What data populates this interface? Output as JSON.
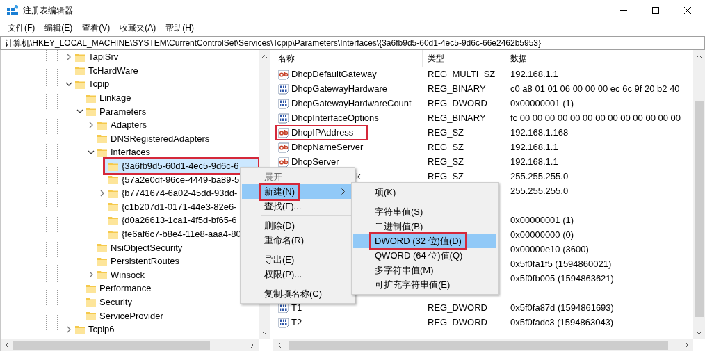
{
  "window": {
    "title": "注册表编辑器"
  },
  "menu_bar": [
    "文件(F)",
    "编辑(E)",
    "查看(V)",
    "收藏夹(A)",
    "帮助(H)"
  ],
  "address_bar": {
    "value": "计算机\\HKEY_LOCAL_MACHINE\\SYSTEM\\CurrentControlSet\\Services\\Tcpip\\Parameters\\Interfaces\\{3a6fb9d5-60d1-4ec5-9d6c-66e2462b5953}"
  },
  "tree": [
    {
      "label": "TapiSrv",
      "kind": "branch",
      "expanded": false,
      "selected": false
    },
    {
      "label": "TcHardWare",
      "kind": "leaf",
      "selected": false
    },
    {
      "label": "Tcpip",
      "kind": "branch",
      "expanded": true,
      "selected": false,
      "children": [
        {
          "label": "Linkage",
          "kind": "leaf",
          "selected": false
        },
        {
          "label": "Parameters",
          "kind": "branch",
          "expanded": true,
          "selected": false,
          "children": [
            {
              "label": "Adapters",
              "kind": "branch",
              "expanded": false,
              "selected": false
            },
            {
              "label": "DNSRegisteredAdapters",
              "kind": "leaf",
              "selected": false
            },
            {
              "label": "Interfaces",
              "kind": "branch",
              "expanded": true,
              "selected": false,
              "children": [
                {
                  "label": "{3a6fb9d5-60d1-4ec5-9d6c-6",
                  "kind": "leaf",
                  "selected": true,
                  "annotated": true
                },
                {
                  "label": "{57a2e0df-96ce-4449-ba89-5",
                  "kind": "leaf",
                  "selected": false
                },
                {
                  "label": "{b7741674-6a02-45dd-93dd-",
                  "kind": "branch",
                  "expanded": false,
                  "selected": false
                },
                {
                  "label": "{c1b207d1-0171-44e3-82e6-",
                  "kind": "leaf",
                  "selected": false
                },
                {
                  "label": "{d0a26613-1ca1-4f5d-bf65-6",
                  "kind": "leaf",
                  "selected": false
                },
                {
                  "label": "{fe6af6c7-b8e4-11e8-aaa4-80",
                  "kind": "leaf",
                  "selected": false
                }
              ]
            },
            {
              "label": "NsiObjectSecurity",
              "kind": "leaf",
              "selected": false
            },
            {
              "label": "PersistentRoutes",
              "kind": "leaf",
              "selected": false
            },
            {
              "label": "Winsock",
              "kind": "branch",
              "expanded": false,
              "selected": false
            }
          ]
        },
        {
          "label": "Performance",
          "kind": "leaf",
          "selected": false
        },
        {
          "label": "Security",
          "kind": "leaf",
          "selected": false
        },
        {
          "label": "ServiceProvider",
          "kind": "leaf",
          "selected": false
        }
      ]
    },
    {
      "label": "Tcpip6",
      "kind": "branch",
      "expanded": false,
      "selected": false
    }
  ],
  "list": {
    "columns": [
      "名称",
      "类型",
      "数据"
    ],
    "rows": [
      {
        "kind": "string",
        "name": "DhcpDefaultGateway",
        "type": "REG_MULTI_SZ",
        "data": "192.168.1.1"
      },
      {
        "kind": "binary",
        "name": "DhcpGatewayHardware",
        "type": "REG_BINARY",
        "data": "c0 a8 01 01 06 00 00 00 ec 6c 9f 20 b2 40"
      },
      {
        "kind": "binary",
        "name": "DhcpGatewayHardwareCount",
        "type": "REG_DWORD",
        "data": "0x00000001 (1)"
      },
      {
        "kind": "binary",
        "name": "DhcpInterfaceOptions",
        "type": "REG_BINARY",
        "data": "fc 00 00 00 00 00 00 00 00 00 00 00 00 00"
      },
      {
        "kind": "string",
        "name": "DhcpIPAddress",
        "type": "REG_SZ",
        "data": "192.168.1.168",
        "annotated": true
      },
      {
        "kind": "string",
        "name": "DhcpNameServer",
        "type": "REG_SZ",
        "data": "192.168.1.1"
      },
      {
        "kind": "string",
        "name": "DhcpServer",
        "type": "REG_SZ",
        "data": "192.168.1.1"
      },
      {
        "kind": "covered",
        "name_tail": "k",
        "type": "REG_SZ",
        "data": "255.255.255.0"
      },
      {
        "kind": "covered",
        "data": "255.255.255.0"
      },
      {
        "kind": "covered"
      },
      {
        "kind": "covered",
        "data": "0x00000001 (1)"
      },
      {
        "kind": "covered",
        "data": "0x00000000 (0)"
      },
      {
        "kind": "covered",
        "data": "0x00000e10 (3600)"
      },
      {
        "kind": "covered",
        "data": "0x5f0fa1f5 (1594860021)"
      },
      {
        "kind": "covered",
        "data": "0x5f0fb005 (1594863621)"
      },
      {
        "kind": "covered"
      },
      {
        "kind": "binary",
        "name": "T1",
        "type": "REG_DWORD",
        "data": "0x5f0fa87d (1594861693)"
      },
      {
        "kind": "binary",
        "name": "T2",
        "type": "REG_DWORD",
        "data": "0x5f0fadc3 (1594863043)"
      }
    ]
  },
  "context_menu": [
    {
      "kind": "item",
      "label": "展开",
      "disabled": true,
      "selected": false
    },
    {
      "kind": "item",
      "label": "新建(N)",
      "submenu": true,
      "selected": true,
      "annotated": true
    },
    {
      "kind": "item",
      "label": "查找(F)...",
      "selected": false
    },
    {
      "kind": "separator"
    },
    {
      "kind": "item",
      "label": "删除(D)",
      "selected": false
    },
    {
      "kind": "item",
      "label": "重命名(R)",
      "selected": false
    },
    {
      "kind": "separator"
    },
    {
      "kind": "item",
      "label": "导出(E)",
      "selected": false
    },
    {
      "kind": "item",
      "label": "权限(P)...",
      "selected": false
    },
    {
      "kind": "separator"
    },
    {
      "kind": "item",
      "label": "复制项名称(C)",
      "selected": false
    }
  ],
  "submenu": [
    {
      "kind": "item",
      "label": "项(K)",
      "selected": false
    },
    {
      "kind": "separator"
    },
    {
      "kind": "item",
      "label": "字符串值(S)",
      "selected": false
    },
    {
      "kind": "item",
      "label": "二进制值(B)",
      "selected": false
    },
    {
      "kind": "item",
      "label": "DWORD (32 位)值(D)",
      "selected": true,
      "annotated": true
    },
    {
      "kind": "item",
      "label": "QWORD (64 位)值(Q)",
      "selected": false
    },
    {
      "kind": "item",
      "label": "多字符串值(M)",
      "selected": false
    },
    {
      "kind": "item",
      "label": "可扩充字符串值(E)",
      "selected": false
    }
  ]
}
